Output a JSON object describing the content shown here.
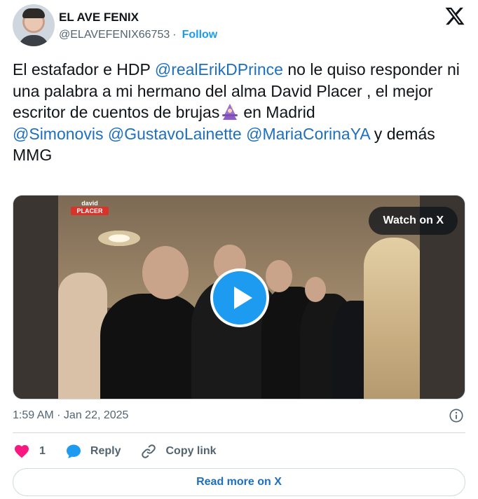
{
  "author": {
    "name": "EL AVE FENIX",
    "handle": "@ELAVEFENIX66753",
    "separator": "·",
    "follow_label": "Follow"
  },
  "tweet": {
    "segments": [
      {
        "text": "El estafador e HDP ",
        "type": "text"
      },
      {
        "text": "@realErikDPrince",
        "type": "mention"
      },
      {
        "text": " no le quiso responder ni una palabra a mi hermano del alma David Placer , el mejor escritor de cuentos de brujas",
        "type": "text"
      },
      {
        "text": "en Madrid",
        "type": "text"
      },
      {
        "text": "@Simonovis",
        "type": "mention"
      },
      {
        "text": "@GustavoLainette",
        "type": "mention"
      },
      {
        "text": "@MariaCorinaYA",
        "type": "mention"
      },
      {
        "text": " y demás MMG",
        "type": "text"
      }
    ],
    "emoji": "witch-emoji"
  },
  "media": {
    "brand_top": "david",
    "brand_bottom": "PLACER",
    "watch_label": "Watch on X",
    "play_icon": "play-icon"
  },
  "meta": {
    "timestamp": "1:59 AM · Jan 22, 2025",
    "info_icon": "info-icon"
  },
  "actions": {
    "like_count": "1",
    "reply_label": "Reply",
    "copy_link_label": "Copy link"
  },
  "read_more_label": "Read more on X",
  "colors": {
    "accent": "#1d9bf0",
    "link": "#1d6fbf",
    "like": "#f91880",
    "muted": "#536471",
    "border": "#cfd9de"
  }
}
